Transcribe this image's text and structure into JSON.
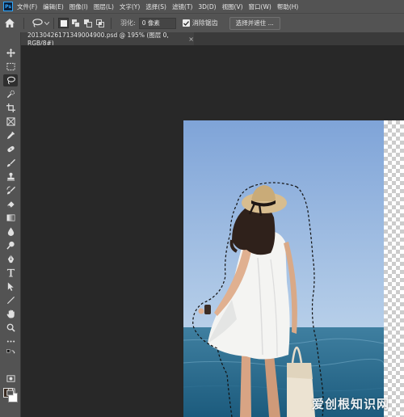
{
  "menubar": {
    "app_icon": "Ps",
    "items": [
      {
        "label": "文件(F)"
      },
      {
        "label": "编辑(E)"
      },
      {
        "label": "图像(I)"
      },
      {
        "label": "图层(L)"
      },
      {
        "label": "文字(Y)"
      },
      {
        "label": "选择(S)"
      },
      {
        "label": "滤镜(T)"
      },
      {
        "label": "3D(D)"
      },
      {
        "label": "视图(V)"
      },
      {
        "label": "窗口(W)"
      },
      {
        "label": "帮助(H)"
      }
    ]
  },
  "options": {
    "feather_label": "羽化:",
    "feather_value": "0 像素",
    "antialias_label": "消除锯齿",
    "antialias_checked": true,
    "select_and_mask_label": "选择并遮住 ..."
  },
  "document_tab": {
    "title": "20130426171349004900.psd @ 195% (图层 0, RGB/8#)",
    "close_symbol": "×"
  },
  "tools": [
    {
      "name": "move-tool",
      "icon": "move-icon"
    },
    {
      "name": "marquee-tool",
      "icon": "marquee-icon"
    },
    {
      "name": "lasso-tool",
      "icon": "lasso-icon",
      "active": true
    },
    {
      "name": "quick-selection-tool",
      "icon": "quick-select-icon"
    },
    {
      "name": "crop-tool",
      "icon": "crop-icon"
    },
    {
      "name": "frame-tool",
      "icon": "frame-icon"
    },
    {
      "name": "eyedropper-tool",
      "icon": "eyedropper-icon"
    },
    {
      "name": "healing-brush-tool",
      "icon": "healing-icon"
    },
    {
      "name": "brush-tool",
      "icon": "brush-icon"
    },
    {
      "name": "clone-stamp-tool",
      "icon": "stamp-icon"
    },
    {
      "name": "history-brush-tool",
      "icon": "history-brush-icon"
    },
    {
      "name": "eraser-tool",
      "icon": "eraser-icon"
    },
    {
      "name": "gradient-tool",
      "icon": "gradient-icon"
    },
    {
      "name": "blur-tool",
      "icon": "blur-icon"
    },
    {
      "name": "dodge-tool",
      "icon": "dodge-icon"
    },
    {
      "name": "pen-tool",
      "icon": "pen-icon"
    },
    {
      "name": "type-tool",
      "icon": "type-icon"
    },
    {
      "name": "path-selection-tool",
      "icon": "path-select-icon"
    },
    {
      "name": "line-tool",
      "icon": "line-icon"
    },
    {
      "name": "hand-tool",
      "icon": "hand-icon"
    },
    {
      "name": "zoom-tool",
      "icon": "zoom-icon"
    },
    {
      "name": "more-tools",
      "icon": "more-icon"
    }
  ],
  "colors": {
    "foreground": "#3a2c22",
    "background": "#ffffff",
    "accent": "#31a8ff"
  },
  "watermark": "爱创根知识网"
}
